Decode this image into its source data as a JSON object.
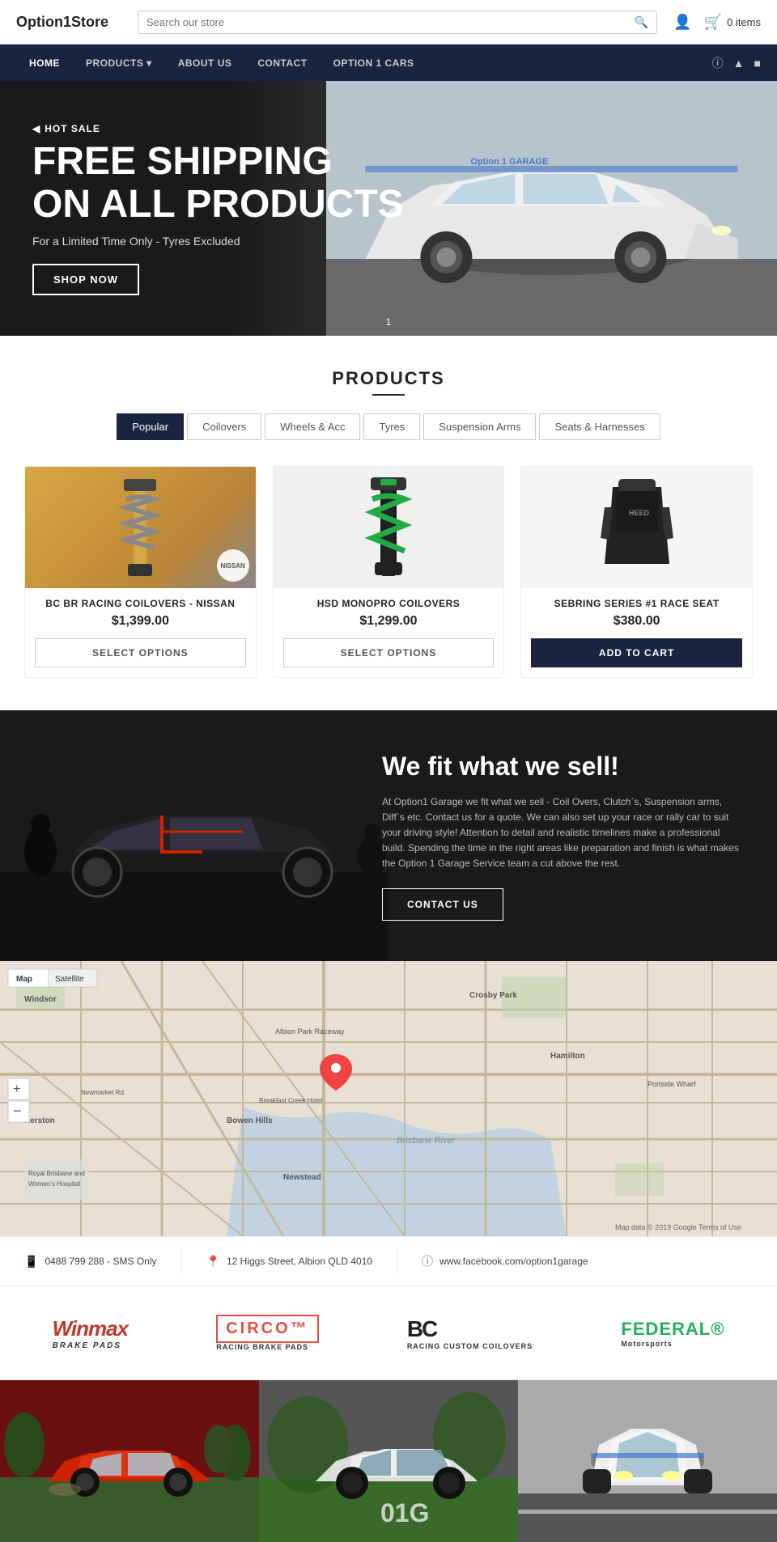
{
  "header": {
    "logo": "Option1Store",
    "search_placeholder": "Search our store",
    "cart_count": "0 items"
  },
  "nav": {
    "items": [
      {
        "label": "HOME",
        "id": "home"
      },
      {
        "label": "PRODUCTS",
        "id": "products",
        "hasDropdown": true
      },
      {
        "label": "ABOUT US",
        "id": "about"
      },
      {
        "label": "CONTACT",
        "id": "contact"
      },
      {
        "label": "OPTION 1 CARS",
        "id": "option1cars"
      }
    ],
    "social": [
      "facebook",
      "twitter",
      "instagram"
    ]
  },
  "hero": {
    "badge": "HOT SALE",
    "title_line1": "FREE SHIPPING",
    "title_line2": "ON ALL PRODUCTS",
    "subtitle": "For a Limited Time Only - Tyres Excluded",
    "cta": "SHOP NOW",
    "indicator": "1"
  },
  "products": {
    "section_title": "PRODUCTS",
    "tabs": [
      {
        "label": "Popular",
        "id": "popular",
        "active": true
      },
      {
        "label": "Coilovers",
        "id": "coilovers"
      },
      {
        "label": "Wheels & Acc",
        "id": "wheels"
      },
      {
        "label": "Tyres",
        "id": "tyres"
      },
      {
        "label": "Suspension Arms",
        "id": "suspension"
      },
      {
        "label": "Seats & Harnesses",
        "id": "seats"
      }
    ],
    "items": [
      {
        "name": "BC BR RACING COILOVERS - NISSAN",
        "price": "$1,399.00",
        "button": "SELECT OPTIONS",
        "button_type": "select",
        "badge": "NISSAN",
        "type": "coilover1"
      },
      {
        "name": "HSD MONOPRO COILOVERS",
        "price": "$1,299.00",
        "button": "SELECT OPTIONS",
        "button_type": "select",
        "type": "coilover2"
      },
      {
        "name": "SEBRING SERIES #1 RACE SEAT",
        "price": "$380.00",
        "button": "ADD TO CART",
        "button_type": "cart",
        "type": "seat"
      }
    ]
  },
  "fit_section": {
    "title": "We fit what we sell!",
    "text": "At Option1 Garage we fit what we sell - Coil Overs, Clutch`s, Suspension arms, Diff`s etc. Contact us for a quote. We can also set up your race or rally car to suit your driving style! Attention to detail and realistic timelines make a professional build. Spending the time in the right areas like preparation and finish is what makes the Option 1 Garage Service team a cut above the rest.",
    "cta": "CONTACT US"
  },
  "map": {
    "controls": [
      "+",
      "-"
    ],
    "type_btns": [
      "Map",
      "Satellite"
    ],
    "credit": "Map data © 2019 Google  Terms of Use",
    "labels": [
      "Windsor",
      "Crosby Park",
      "Hamilton",
      "Albion Park Raceway",
      "Bowen Hills",
      "Newstead",
      "Herston",
      "Portside Wharf"
    ]
  },
  "contact_bar": {
    "phone": "0488 799 288 - SMS Only",
    "address": "12 Higgs Street, Albion QLD 4010",
    "facebook": "www.facebook.com/option1garage"
  },
  "brands": [
    {
      "name": "Winmax",
      "subtitle": "BRAKE PADS",
      "class": "brand-winmax"
    },
    {
      "name": "CIRCO™ RACING BRAKE PADS",
      "class": "brand-circo"
    },
    {
      "name": "BC RACING CUSTOM COILOVERS",
      "class": "brand-bc"
    },
    {
      "name": "FEDERAL® Motorsports",
      "class": "brand-federal"
    }
  ],
  "gallery": [
    {
      "text": "",
      "bg": "gallery-item-1"
    },
    {
      "text": "01G",
      "bg": "gallery-item-2"
    },
    {
      "text": "",
      "bg": "gallery-item-3"
    }
  ]
}
